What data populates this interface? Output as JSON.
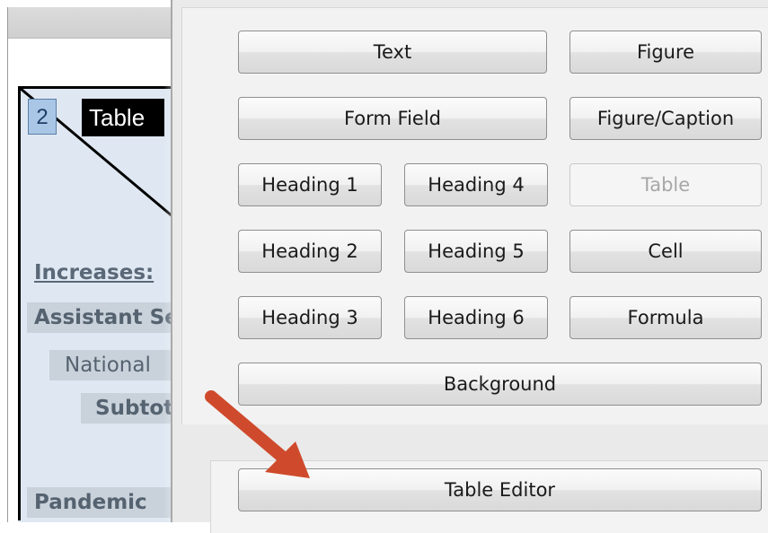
{
  "document": {
    "tag_number": "2",
    "tag_label": "Table",
    "row_labels": {
      "increases": "Increases:",
      "assistant": "Assistant Se",
      "national": "National",
      "subtotal": "Subtotal",
      "pandemic": "Pandemic"
    }
  },
  "panel": {
    "buttons": {
      "text": "Text",
      "figure": "Figure",
      "form_field": "Form Field",
      "figure_caption": "Figure/Caption",
      "heading1": "Heading 1",
      "heading4": "Heading 4",
      "table": "Table",
      "heading2": "Heading 2",
      "heading5": "Heading 5",
      "cell": "Cell",
      "heading3": "Heading 3",
      "heading6": "Heading 6",
      "formula": "Formula",
      "background": "Background",
      "table_editor": "Table Editor"
    },
    "table_button_disabled": true
  },
  "colors": {
    "arrow": "#cf4a2c",
    "highlight_tag": "#a9c6e6",
    "page_background": "#dfe8f2"
  }
}
